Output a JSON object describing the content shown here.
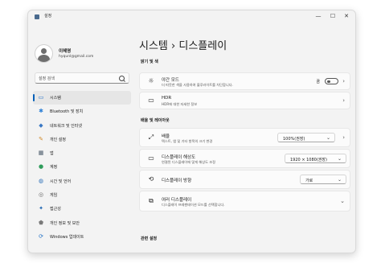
{
  "window": {
    "title": "설정",
    "controls": {
      "minimize": "—",
      "maximize": "☐",
      "close": "✕"
    }
  },
  "user": {
    "name": "이혜영",
    "email": "hyqunl@gmail.com"
  },
  "search": {
    "placeholder": "설정 검색"
  },
  "nav": [
    {
      "label": "시스템",
      "icon": "monitor-icon",
      "glyph": "▭",
      "color": "#1f6fc5",
      "active": true
    },
    {
      "label": "Bluetooth 및 장치",
      "icon": "bluetooth-icon",
      "glyph": "✱",
      "color": "#2b7fd6"
    },
    {
      "label": "네트워크 및 인터넷",
      "icon": "network-icon",
      "glyph": "◆",
      "color": "#3a78c4"
    },
    {
      "label": "개인 설정",
      "icon": "brush-icon",
      "glyph": "✎",
      "color": "#d18a2a"
    },
    {
      "label": "앱",
      "icon": "apps-icon",
      "glyph": "▦",
      "color": "#4a5a6a"
    },
    {
      "label": "계정",
      "icon": "account-icon",
      "glyph": "●",
      "color": "#2f9c5b"
    },
    {
      "label": "시간 및 언어",
      "icon": "globe-clock-icon",
      "glyph": "◍",
      "color": "#2b6fb8"
    },
    {
      "label": "게임",
      "icon": "gamepad-icon",
      "glyph": "◎",
      "color": "#666666"
    },
    {
      "label": "접근성",
      "icon": "accessibility-icon",
      "glyph": "✦",
      "color": "#1a63b0"
    },
    {
      "label": "개인 정보 및 보안",
      "icon": "shield-icon",
      "glyph": "⬟",
      "color": "#7a7a7a"
    },
    {
      "label": "Windows 업데이트",
      "icon": "update-icon",
      "glyph": "⟳",
      "color": "#1f6fc5"
    }
  ],
  "breadcrumb": {
    "parent": "시스템",
    "separator": "›",
    "current": "디스플레이"
  },
  "sections": {
    "brightness": "밝기 및 색",
    "scale_layout": "배율 및 레이아웃",
    "related": "관련 설정"
  },
  "cards": {
    "night_light": {
      "title": "야간 모드",
      "subtitle": "더 따뜻한 색을 사용하여 블루라이트를 차단합니다.",
      "toggle_label": "끔",
      "toggle_on": false,
      "icon": "sun-icon",
      "glyph": "☼"
    },
    "hdr": {
      "title": "HDR",
      "subtitle": "HDR에 대한 자세한 정보",
      "icon": "hdr-icon",
      "glyph": "▭"
    },
    "scale": {
      "title": "배율",
      "subtitle": "텍스트, 앱 및 기타 항목의 크기 변경",
      "value": "100%(권장)",
      "icon": "scale-icon",
      "glyph": "⤢"
    },
    "resolution": {
      "title": "디스플레이 해상도",
      "subtitle": "연결된 디스플레이에 맞게 해상도 조정",
      "value": "1920 × 1080(권장)",
      "icon": "resolution-icon",
      "glyph": "▭"
    },
    "orientation": {
      "title": "디스플레이 방향",
      "value": "가로",
      "icon": "orientation-icon",
      "glyph": "⟲"
    },
    "multiple_displays": {
      "title": "여러 디스플레이",
      "subtitle": "디스플레이 프레젠테이션 모드를 선택합니다.",
      "icon": "multiple-displays-icon",
      "glyph": "⧉"
    }
  },
  "glyphs": {
    "chevron_right": "›",
    "chevron_down": "⌄"
  }
}
